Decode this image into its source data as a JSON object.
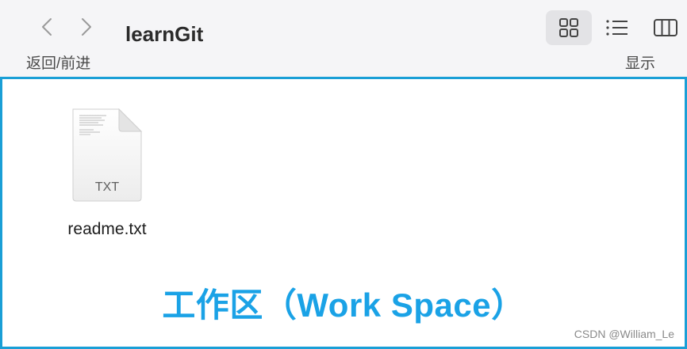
{
  "toolbar": {
    "title": "learnGit",
    "nav_caption": "返回/前进",
    "view_caption": "显示"
  },
  "files": [
    {
      "name": "readme.txt",
      "type_label": "TXT"
    }
  ],
  "workspace_label": "工作区（Work Space）",
  "watermark": "CSDN @William_Le",
  "colors": {
    "accent": "#1a9fd6",
    "label": "#1aa2e6",
    "toolbar_bg": "#f5f5f7"
  }
}
